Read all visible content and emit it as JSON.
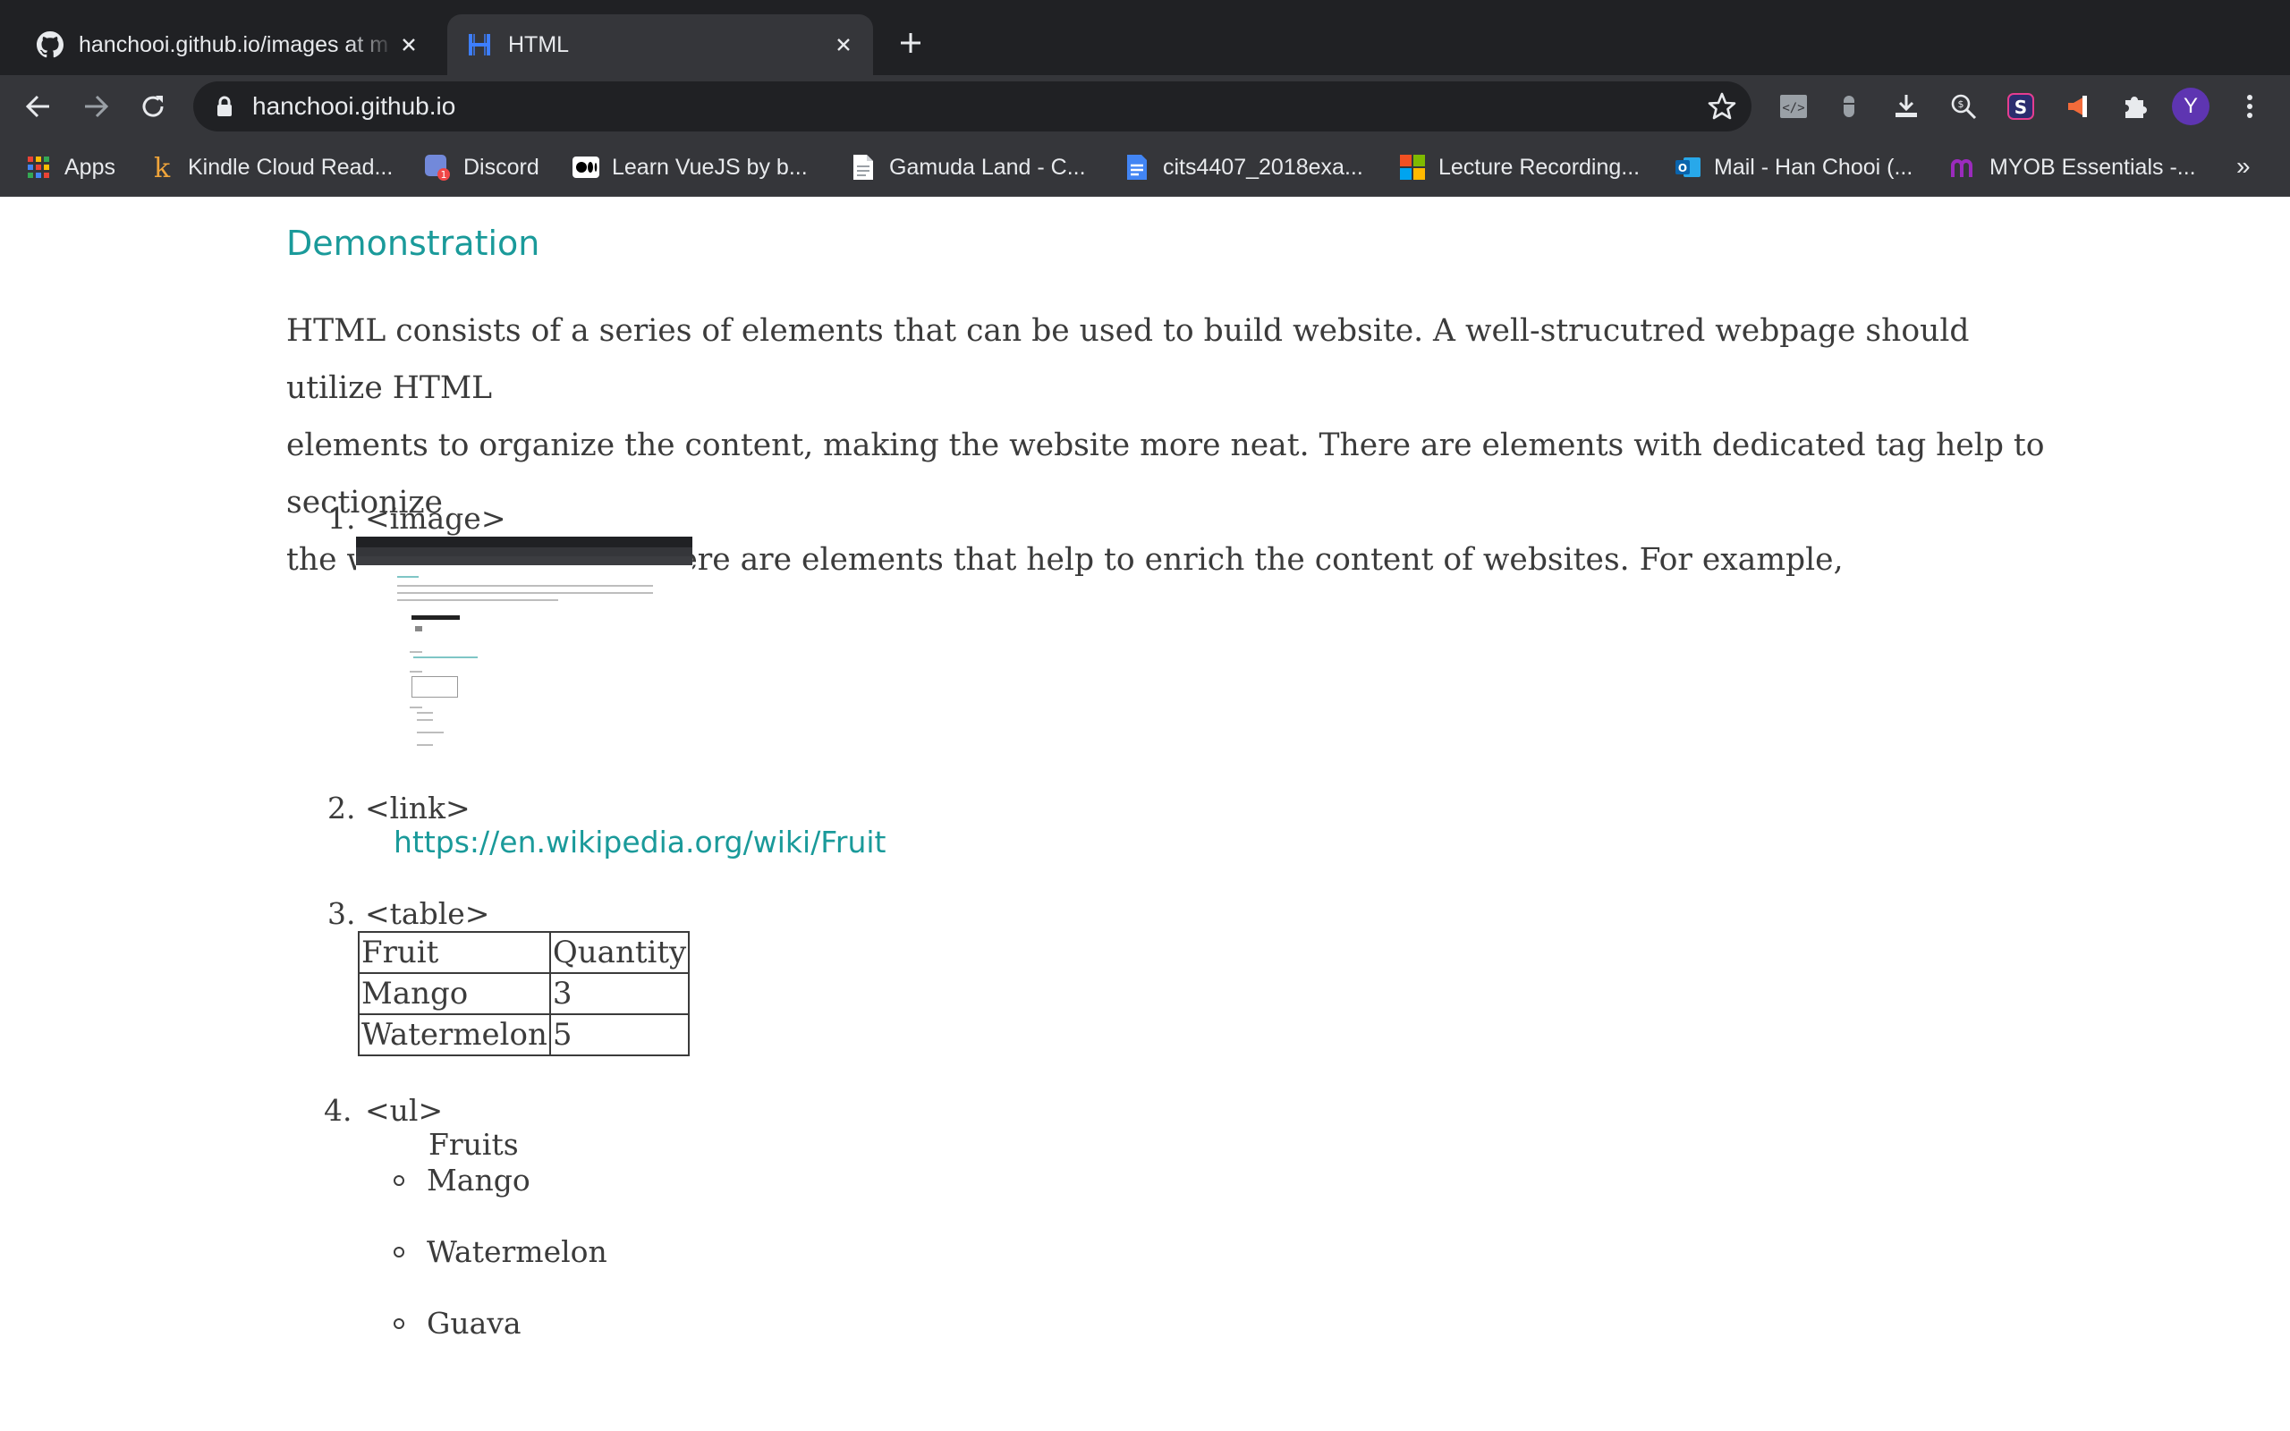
{
  "browser": {
    "tabs": [
      {
        "title": "hanchooi.github.io/images at m",
        "favicon": "github-icon",
        "active": false
      },
      {
        "title": "HTML",
        "favicon": "h-logo-icon",
        "active": true
      }
    ],
    "new_tab_label": "+",
    "address": "hanchooi.github.io",
    "profile_initial": "Y",
    "bookmarks": [
      {
        "label": "Apps",
        "icon": "apps-grid-icon"
      },
      {
        "label": "Kindle Cloud Read...",
        "icon": "kindle-icon"
      },
      {
        "label": "Discord",
        "icon": "discord-icon"
      },
      {
        "label": "Learn VueJS by b...",
        "icon": "medium-icon"
      },
      {
        "label": "Gamuda Land - C...",
        "icon": "document-icon"
      },
      {
        "label": "cits4407_2018exa...",
        "icon": "google-docs-icon"
      },
      {
        "label": "Lecture Recording...",
        "icon": "microsoft-icon"
      },
      {
        "label": "Mail - Han Chooi (...",
        "icon": "outlook-icon"
      },
      {
        "label": "MYOB Essentials -...",
        "icon": "myob-icon"
      }
    ],
    "bookmarks_overflow": "»",
    "accent_colors": {
      "chrome_dark": "#202124",
      "toolbar": "#35363a",
      "profile": "#5e35b1"
    }
  },
  "page": {
    "section_heading": "Demonstration",
    "intro_lines": [
      "HTML consists of a series of elements that can be used to build website. A well-strucutred webpage should utilize HTML",
      "elements to organize the content, making the website more neat. There are elements with dedicated tag help to sectionize",
      "the webpage. Besides, there are elements that help to enrich the content of websites. For example,"
    ],
    "items": [
      {
        "number": "1.",
        "tag": "<image>"
      },
      {
        "number": "2.",
        "tag": "<link>"
      },
      {
        "number": "3.",
        "tag": "<table>"
      },
      {
        "number": "4.",
        "tag": "<ul>"
      }
    ],
    "link_text": "https://en.wikipedia.org/wiki/Fruit",
    "table": {
      "headers": [
        "Fruit",
        "Quantity"
      ],
      "rows": [
        [
          "Mango",
          "3"
        ],
        [
          "Watermelon",
          "5"
        ]
      ]
    },
    "list_caption": "Fruits",
    "list_items": [
      "Mango",
      "Watermelon",
      "Guava"
    ],
    "accent_color": "#1a9a9a"
  }
}
